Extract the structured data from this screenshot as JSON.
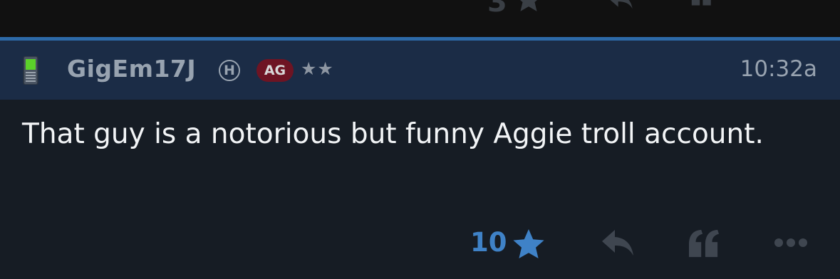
{
  "previous_post": {
    "like_count": "3"
  },
  "post": {
    "username": "GigEm17J",
    "h_badge": "H",
    "team_badge": "AG",
    "rank_stars": "★★",
    "time": "10:32a",
    "body": "That guy is a notorious but funny Aggie troll account.",
    "like_count": "10"
  },
  "colors": {
    "header_bg": "#1b2c46",
    "body_bg": "#161c24",
    "accent_blue": "#3f82c7",
    "team_badge": "#6e1423",
    "muted_text": "#98a3b0"
  },
  "icons": {
    "device": "phone-icon",
    "like": "star-icon",
    "reply": "reply-icon",
    "quote": "quote-icon",
    "more": "more-icon"
  }
}
